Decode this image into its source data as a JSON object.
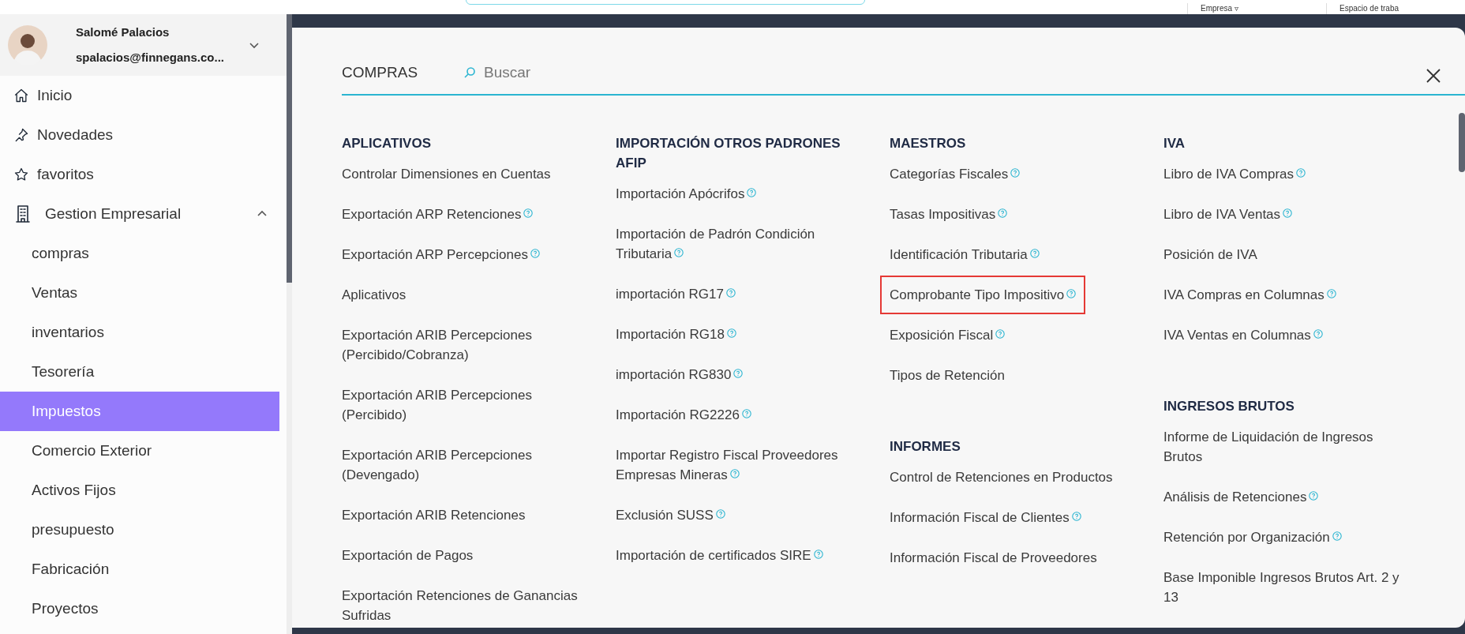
{
  "top_bar": {
    "workspace_menus": [
      {
        "label": "Empresa",
        "caret": "▿"
      },
      {
        "label": "Espacio de traba"
      }
    ]
  },
  "user": {
    "name": "Salomé Palacios",
    "email": "spalacios@finnegans.co..."
  },
  "sidebar": {
    "items": [
      {
        "label": "Inicio",
        "selected": false
      },
      {
        "label": "Novedades",
        "selected": false
      },
      {
        "label": "favoritos",
        "selected": false
      },
      {
        "label": "Gestion Empresarial",
        "selected": false,
        "expanded": true,
        "children": [
          {
            "label": "compras",
            "selected": false
          },
          {
            "label": "Ventas",
            "selected": false
          },
          {
            "label": "inventarios",
            "selected": false
          },
          {
            "label": "Tesorería",
            "selected": false
          },
          {
            "label": "Impuestos",
            "selected": true
          },
          {
            "label": "Comercio Exterior",
            "selected": false
          },
          {
            "label": "Activos Fijos",
            "selected": false
          },
          {
            "label": "presupuesto",
            "selected": false
          },
          {
            "label": "Fabricación",
            "selected": false
          },
          {
            "label": "Proyectos",
            "selected": false
          }
        ]
      }
    ]
  },
  "panel": {
    "title": "COMPRAS",
    "search": {
      "placeholder": "Buscar"
    },
    "columns": [
      {
        "sections": [
          {
            "title": "APLICATIVOS",
            "items": [
              {
                "label": "Controlar Dimensiones en Cuentas",
                "help": false,
                "highlighted": false
              },
              {
                "label": "Exportación ARP Retenciones",
                "help": true,
                "highlighted": false
              },
              {
                "label": "Exportación ARP Percepciones",
                "help": true,
                "highlighted": false
              },
              {
                "label": "Aplicativos",
                "help": false,
                "highlighted": false
              },
              {
                "label": "Exportación ARIB Percepciones (Percibido/Cobranza)",
                "help": false,
                "highlighted": false
              },
              {
                "label": "Exportación ARIB Percepciones (Percibido)",
                "help": false,
                "highlighted": false
              },
              {
                "label": "Exportación ARIB Percepciones (Devengado)",
                "help": false,
                "highlighted": false
              },
              {
                "label": "Exportación ARIB Retenciones",
                "help": false,
                "highlighted": false
              },
              {
                "label": "Exportación de Pagos",
                "help": false,
                "highlighted": false
              },
              {
                "label": "Exportación Retenciones de Ganancias Sufridas",
                "help": false,
                "highlighted": false
              }
            ]
          }
        ]
      },
      {
        "sections": [
          {
            "title": "IMPORTACIÓN OTROS PADRONES AFIP",
            "items": [
              {
                "label": "Importación Apócrifos",
                "help": true,
                "highlighted": false
              },
              {
                "label": "Importación de Padrón Condición Tributaria",
                "help": true,
                "highlighted": false
              },
              {
                "label": "importación RG17",
                "help": true,
                "highlighted": false
              },
              {
                "label": "Importación RG18",
                "help": true,
                "highlighted": false
              },
              {
                "label": "importación RG830",
                "help": true,
                "highlighted": false
              },
              {
                "label": "Importación RG2226",
                "help": true,
                "highlighted": false
              },
              {
                "label": "Importar Registro Fiscal Proveedores Empresas Mineras",
                "help": true,
                "highlighted": false
              },
              {
                "label": "Exclusión SUSS",
                "help": true,
                "highlighted": false
              },
              {
                "label": "Importación de certificados SIRE",
                "help": true,
                "highlighted": false
              }
            ]
          }
        ]
      },
      {
        "sections": [
          {
            "title": "MAESTROS",
            "items": [
              {
                "label": "Categorías Fiscales",
                "help": true,
                "highlighted": false
              },
              {
                "label": "Tasas Impositivas",
                "help": true,
                "highlighted": false
              },
              {
                "label": "Identificación Tributaria",
                "help": true,
                "highlighted": false
              },
              {
                "label": "Comprobante Tipo Impositivo",
                "help": true,
                "highlighted": true
              },
              {
                "label": "Exposición Fiscal",
                "help": true,
                "highlighted": false
              },
              {
                "label": "Tipos de Retención",
                "help": false,
                "highlighted": false
              }
            ]
          },
          {
            "title": "INFORMES",
            "items": [
              {
                "label": "Control de Retenciones en Productos",
                "help": false,
                "highlighted": false
              },
              {
                "label": "Información Fiscal de Clientes",
                "help": true,
                "highlighted": false
              },
              {
                "label": "Información Fiscal de Proveedores",
                "help": false,
                "highlighted": false
              }
            ]
          }
        ]
      },
      {
        "sections": [
          {
            "title": "IVA",
            "items": [
              {
                "label": "Libro de IVA Compras",
                "help": true,
                "highlighted": false
              },
              {
                "label": "Libro de IVA Ventas",
                "help": true,
                "highlighted": false
              },
              {
                "label": "Posición de IVA",
                "help": false,
                "highlighted": false
              },
              {
                "label": "IVA Compras en Columnas",
                "help": true,
                "highlighted": false
              },
              {
                "label": "IVA Ventas en Columnas",
                "help": true,
                "highlighted": false
              }
            ]
          },
          {
            "title": "INGRESOS BRUTOS",
            "items": [
              {
                "label": "Informe de Liquidación de Ingresos Brutos",
                "help": false,
                "highlighted": false
              },
              {
                "label": "Análisis de Retenciones",
                "help": true,
                "highlighted": false
              },
              {
                "label": "Retención por Organización",
                "help": true,
                "highlighted": false
              },
              {
                "label": "Base Imponible Ingresos Brutos Art. 2 y 13",
                "help": false,
                "highlighted": false
              }
            ]
          }
        ]
      }
    ]
  }
}
